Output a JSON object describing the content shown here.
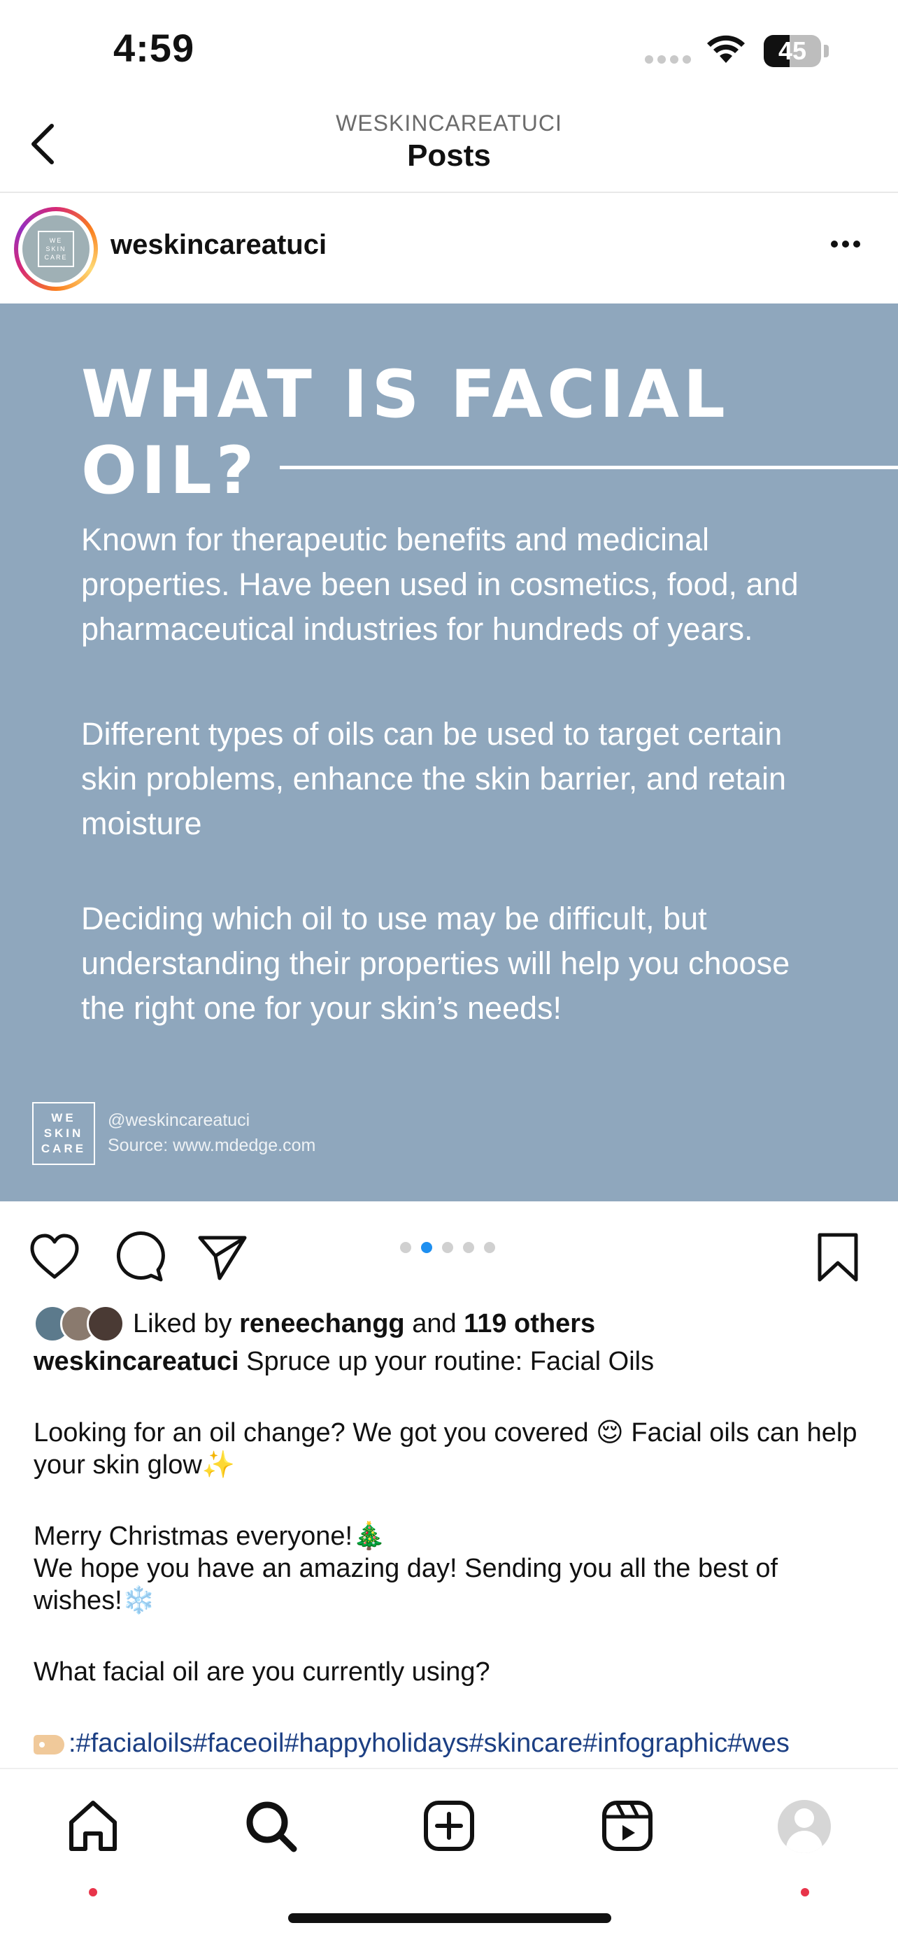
{
  "status_bar": {
    "time": "4:59",
    "battery": "45",
    "battery_level": 0.45
  },
  "nav": {
    "subtitle": "WESKINCAREATUCI",
    "title": "Posts"
  },
  "post": {
    "username": "weskincareatuci",
    "avatar_text": "WE SKIN CARE",
    "image": {
      "title": "WHAT IS FACIAL OIL?",
      "paragraphs": [
        "Known for therapeutic benefits and medicinal properties. Have been used in cosmetics, food, and pharmaceutical industries for hundreds of years.",
        "Different types of oils can be used to target certain skin problems, enhance the skin barrier, and retain moisture",
        "Deciding which oil to use may be difficult, but understanding their properties will help you choose the right one for your skin’s needs!"
      ],
      "logo_text": "WE SKIN CARE",
      "handle": "@weskincareatuci",
      "source": "Source: www.mdedge.com",
      "background_color": "#8fa7bd"
    },
    "carousel": {
      "count": 5,
      "active_index": 1
    },
    "likes": {
      "prefix": "Liked by",
      "user": "reneechangg",
      "joiner": "and",
      "others": "119 others"
    },
    "caption": {
      "username": "weskincareatuci",
      "headline": "Spruce up your routine: Facial Oils",
      "line1": "Looking for an oil change? We got you covered 😌 Facial oils can help your skin glow✨",
      "line2": "Merry Christmas everyone!🎄",
      "line3": "We hope you have an amazing day! Sending you all the best of wishes!❄️",
      "line4": "What facial oil are you currently using?",
      "hashtags": ":#facialoils#faceoil#happyholidays#skincare#infographic#wes"
    }
  },
  "icons": {
    "back": "chevron-left-icon",
    "more": "ellipsis-icon",
    "like": "heart-icon",
    "comment": "comment-icon",
    "share": "paper-plane-icon",
    "save": "bookmark-icon",
    "tabs": [
      "home-icon",
      "search-icon",
      "create-icon",
      "reels-icon",
      "profile-icon"
    ]
  },
  "colors": {
    "notification_dot": "#e8344a",
    "carousel_active": "#1e8ff0",
    "hashtag": "#1c3f83"
  }
}
